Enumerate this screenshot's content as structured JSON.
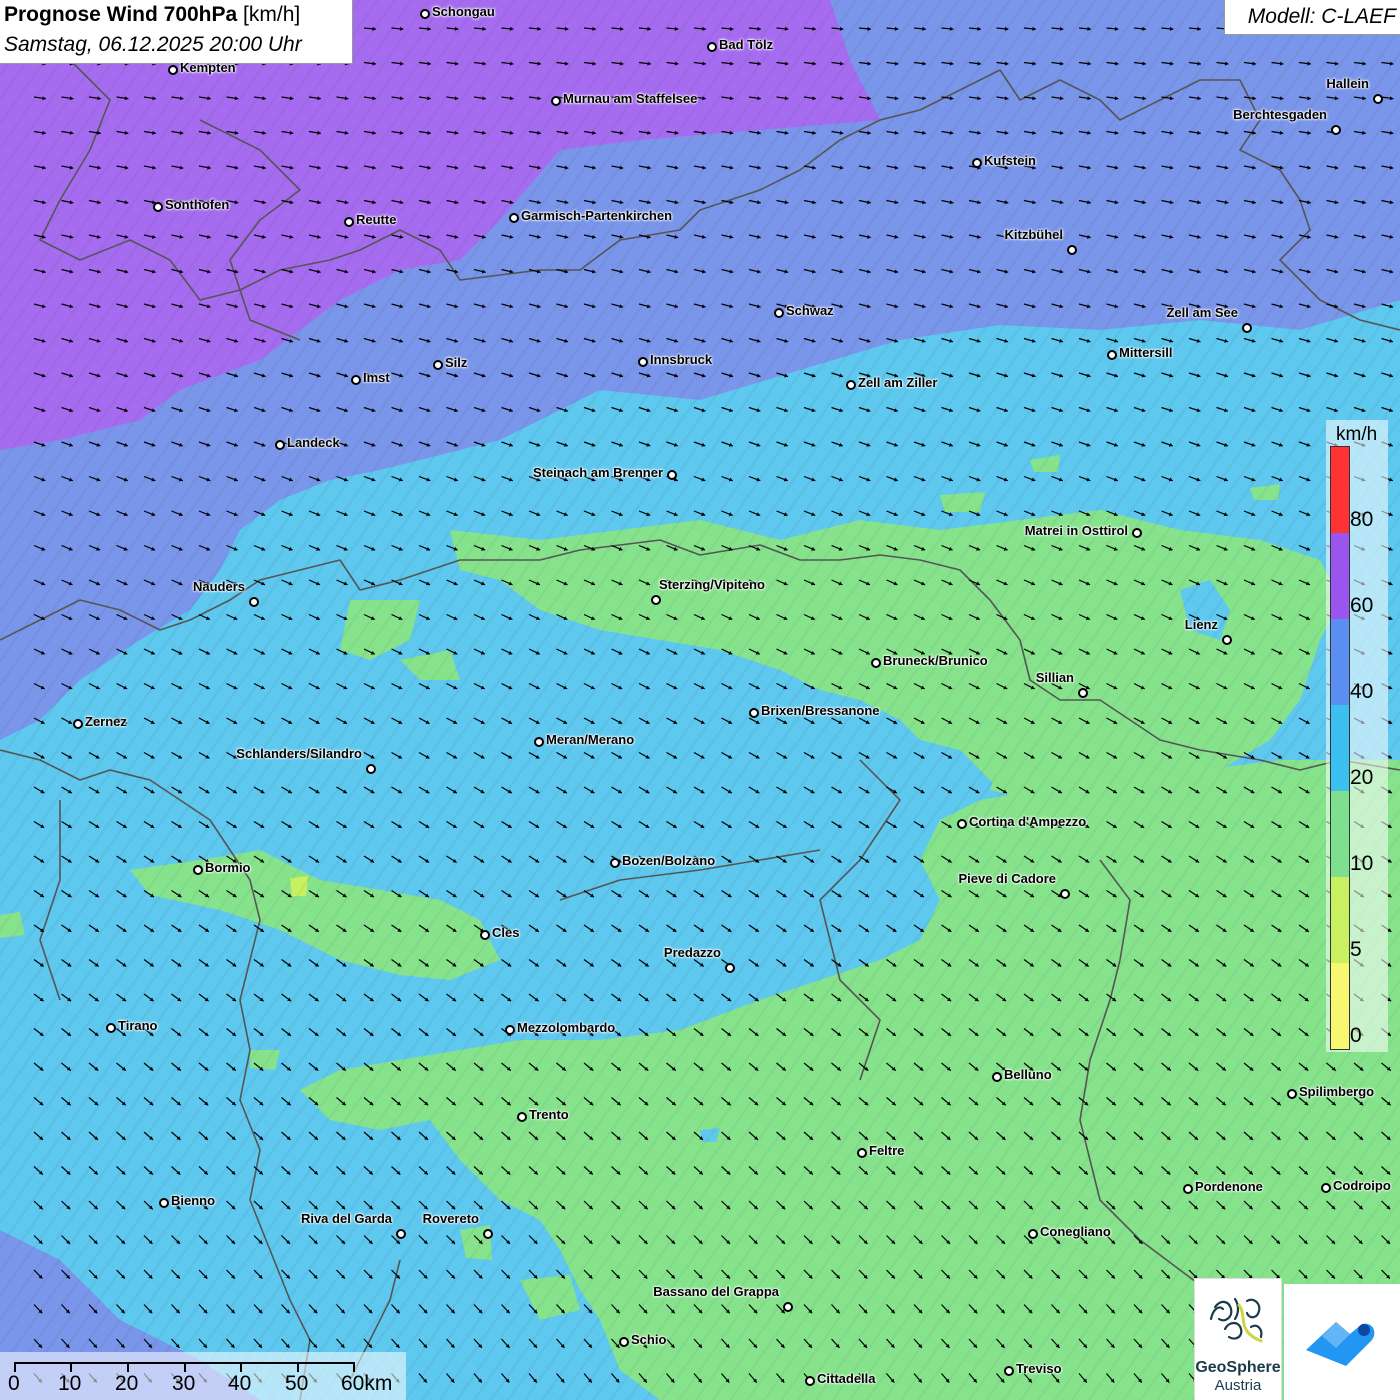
{
  "header": {
    "title_bold": "Prognose Wind 700hPa",
    "title_unit": "[km/h]",
    "datetime": "Samstag, 06.12.2025 20:00 Uhr",
    "model": "Modell: C-LAEF"
  },
  "legend": {
    "unit": "km/h",
    "ticks": [
      "80",
      "60",
      "40",
      "20",
      "10",
      "5",
      "0"
    ],
    "colors": [
      "#ff3333",
      "#9a55ee",
      "#5a8ef0",
      "#3cc0f0",
      "#7ee08e",
      "#c8f060",
      "#f8f870"
    ]
  },
  "map_colors": {
    "purple": "#a66cf0",
    "blue": "#7a96ea",
    "light_blue": "#5ec8ee",
    "green": "#86e38c",
    "border": "#555555"
  },
  "wind": {
    "arrow_color": "#000000",
    "direction": "east-southeast"
  },
  "cities": [
    {
      "name": "Schongau"
    },
    {
      "name": "Bad Tölz"
    },
    {
      "name": "Kempten"
    },
    {
      "name": "Murnau am Staffelsee"
    },
    {
      "name": "Hallein"
    },
    {
      "name": "Berchtesgaden"
    },
    {
      "name": "Kufstein"
    },
    {
      "name": "Sonthofen"
    },
    {
      "name": "Reutte"
    },
    {
      "name": "Garmisch-Partenkirchen"
    },
    {
      "name": "Kitzbühel"
    },
    {
      "name": "Schwaz"
    },
    {
      "name": "Zell am See"
    },
    {
      "name": "Mittersill"
    },
    {
      "name": "Innsbruck"
    },
    {
      "name": "Silz"
    },
    {
      "name": "Imst"
    },
    {
      "name": "Zell am Ziller"
    },
    {
      "name": "Landeck"
    },
    {
      "name": "Steinach am Brenner"
    },
    {
      "name": "Matrei in Osttirol"
    },
    {
      "name": "Nauders"
    },
    {
      "name": "Sterzing/Vipiteno"
    },
    {
      "name": "Lienz"
    },
    {
      "name": "Bruneck/Brunico"
    },
    {
      "name": "Sillian"
    },
    {
      "name": "Zernez"
    },
    {
      "name": "Brixen/Bressanone"
    },
    {
      "name": "Meran/Merano"
    },
    {
      "name": "Schlanders/Silandro"
    },
    {
      "name": "Cortina d'Ampezzo"
    },
    {
      "name": "Bozen/Bolzano"
    },
    {
      "name": "Bormio"
    },
    {
      "name": "Pieve di Cadore"
    },
    {
      "name": "Cles"
    },
    {
      "name": "Predazzo"
    },
    {
      "name": "Tirano"
    },
    {
      "name": "Mezzolombardo"
    },
    {
      "name": "Belluno"
    },
    {
      "name": "Spilimbergo"
    },
    {
      "name": "Trento"
    },
    {
      "name": "Feltre"
    },
    {
      "name": "Bienno"
    },
    {
      "name": "Pordenone"
    },
    {
      "name": "Codroipo"
    },
    {
      "name": "Riva del Garda"
    },
    {
      "name": "Rovereto"
    },
    {
      "name": "Conegliano"
    },
    {
      "name": "Bassano del Grappa"
    },
    {
      "name": "Schio"
    },
    {
      "name": "Treviso"
    },
    {
      "name": "Cittadella"
    }
  ],
  "scale": {
    "labels": [
      "0",
      "10",
      "20",
      "30",
      "40",
      "50",
      "60km"
    ]
  },
  "logos": {
    "geosphere_line1": "GeoSphere",
    "geosphere_line2": "Austria"
  }
}
